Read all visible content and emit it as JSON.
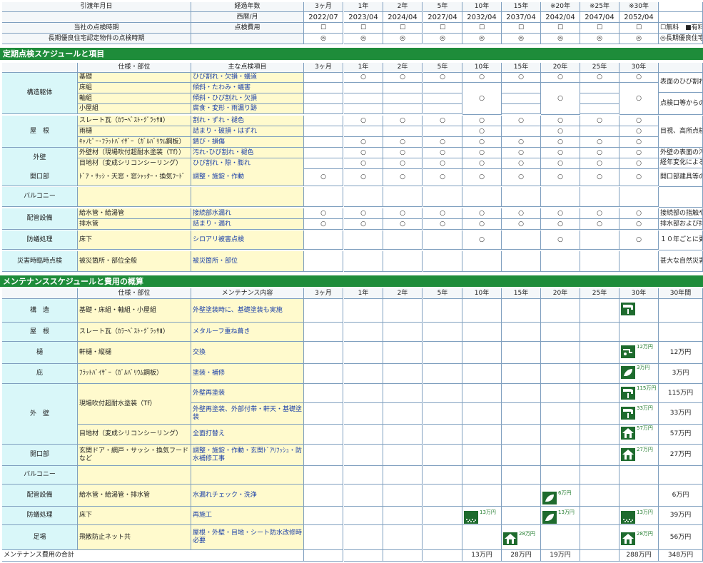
{
  "sched_head": {
    "r1_label": "引渡年月日",
    "r1_mid": "経過年数",
    "r2_mid": "西暦/月",
    "years": [
      "3ヶ月",
      "1年",
      "2年",
      "5年",
      "10年",
      "15年",
      "※20年",
      "※25年",
      "※30年"
    ],
    "dates": [
      "2022/07",
      "2023/04",
      "2024/04",
      "2027/04",
      "2032/04",
      "2037/04",
      "2042/04",
      "2047/04",
      "2052/04"
    ],
    "r3_label": "当社の点検時期",
    "r3_mid": "点検費用",
    "r3_marks": [
      "☐",
      "☐",
      "☐",
      "☐",
      "☐",
      "☐",
      "☐",
      "☐",
      "☐"
    ],
    "r3_note": "☐無料　■有料",
    "r4_label": "長期優良住宅認定物件の点検時期",
    "r4_marks": [
      "◎",
      "◎",
      "◎",
      "◎",
      "◎",
      "◎",
      "◎",
      "◎",
      "◎"
    ],
    "r4_note": "◎長期優良住宅"
  },
  "section1": {
    "title": "定期点検スケジュールと項目",
    "col_spec": "仕様・部位",
    "col_item": "主な点検項目",
    "intervals": [
      "3ヶ月",
      "1年",
      "2年",
      "5年",
      "10年",
      "15年",
      "20年",
      "25年",
      "30年"
    ],
    "groups": [
      {
        "name": "構造躯体",
        "note": "表面のひび割れ",
        "note2": "点検口等からの"
      },
      {
        "name": "屋　根",
        "note": "目視、高所点検"
      },
      {
        "name": "外壁",
        "note": "外壁の表面の汚",
        "note2": "経年変化による"
      },
      {
        "name": "開口部",
        "note": "開口部建具等の"
      },
      {
        "name": "バルコニー"
      },
      {
        "name": "配管設備",
        "note": "接続部の指触や",
        "note2": "排水部および排"
      },
      {
        "name": "防蟻処理",
        "note": "１０年ごとに更"
      },
      {
        "name": "災害時臨時点検",
        "note": "甚大な自然災害"
      }
    ],
    "rows": [
      {
        "spec": "基礎",
        "item": "ひび割れ・欠損・蟻道",
        "marks": [
          "",
          "○",
          "○",
          "○",
          "○",
          "○",
          "○",
          "○",
          "○"
        ]
      },
      {
        "spec": "床組",
        "item": "傾斜・たわみ・蟻害"
      },
      {
        "spec": "軸組",
        "item": "傾斜・ひび割れ・欠損"
      },
      {
        "spec": "小屋組",
        "item": "腐食・変形・雨漏り跡"
      },
      {
        "spec": "スレート瓦（ｶﾗｰﾍﾞｽﾄ･ｸﾞﾗｯｻⅡ）",
        "item": "割れ・ずれ・褪色",
        "marks": [
          "",
          "○",
          "○",
          "○",
          "○",
          "○",
          "○",
          "○",
          "○"
        ]
      },
      {
        "spec": "雨樋",
        "item": "詰まり・破損・はずれ",
        "marks": [
          "",
          "",
          "",
          "",
          "○",
          "",
          "○",
          "",
          "○"
        ]
      },
      {
        "spec": "ｷｬﾉﾋﾟｰ･ﾌﾗｯﾄﾊﾞｲｻﾞｰ（ｶﾞﾙﾊﾞﾘｳﾑ鋼板）",
        "item": "錆び・損傷",
        "marks": [
          "",
          "○",
          "○",
          "○",
          "○",
          "○",
          "○",
          "○",
          "○"
        ]
      },
      {
        "spec": "外壁材（現場吹付超耐水塗装（Tf））",
        "item": "汚れ･ひび割れ・褪色",
        "marks": [
          "",
          "○",
          "○",
          "○",
          "○",
          "○",
          "○",
          "○",
          "○"
        ]
      },
      {
        "spec": "目地材（変成シリコンシーリング）",
        "item": "ひび割れ・隙・膨れ",
        "marks": [
          "",
          "○",
          "○",
          "○",
          "○",
          "○",
          "○",
          "○",
          "○"
        ]
      },
      {
        "spec": "ﾄﾞｱ・ｻｯｼ・天窓・窓ｼｬｯﾀｰ・換気ﾌｰﾄﾞ",
        "item": "調整・施錠・作動",
        "marks": [
          "○",
          "○",
          "○",
          "○",
          "○",
          "○",
          "○",
          "○",
          "○"
        ]
      },
      {
        "spec": "",
        "item": ""
      },
      {
        "spec": "給水管・給湯管",
        "item": "接続部水漏れ",
        "marks": [
          "○",
          "○",
          "○",
          "○",
          "○",
          "○",
          "○",
          "○",
          "○"
        ]
      },
      {
        "spec": "排水管",
        "item": "詰まり・漏れ",
        "marks": [
          "○",
          "○",
          "○",
          "○",
          "○",
          "○",
          "○",
          "○",
          "○"
        ]
      },
      {
        "spec": "床下",
        "item": "シロアリ被害点検",
        "marks": [
          "",
          "",
          "",
          "",
          "○",
          "",
          "○",
          "",
          "○"
        ]
      },
      {
        "spec": "被災箇所・部位全般",
        "item": "被災箇所・部位"
      }
    ],
    "structure_marks": [
      "○",
      "○",
      "○"
    ]
  },
  "section2": {
    "title": "メンテナンススケジュールと費用の概算",
    "col_spec": "仕様・部位",
    "col_item": "メンテナンス内容",
    "intervals": [
      "3ヶ月",
      "1年",
      "2年",
      "5年",
      "10年",
      "15年",
      "20年",
      "25年",
      "30年",
      "30年間"
    ],
    "rows": [
      {
        "group": "構　造",
        "spec": "基礎・床組・軸組・小屋組",
        "item": "外壁塗装時に、基礎塗装も実施",
        "total": ""
      },
      {
        "group": "屋　根",
        "spec": "スレート瓦（ｶﾗｰﾍﾞｽﾄ･ｸﾞﾗｯｻⅡ）",
        "item": "メタルーフ重ね葺き",
        "total": ""
      },
      {
        "group": "樋",
        "spec": "軒樋・縦樋",
        "item": "交換",
        "total": "12万円"
      },
      {
        "group": "庇",
        "spec": "ﾌﾗｯﾄﾊﾞｲｻﾞｰ（ｶﾞﾙﾊﾞﾘｳﾑ鋼板）",
        "item": "塗装・補修",
        "total": "3万円"
      },
      {
        "group": "外　壁",
        "spec": "現場吹付超耐水塗装（Tf）",
        "item": "外壁再塗装",
        "total": "115万円"
      },
      {
        "group": "",
        "spec": "",
        "item": "外壁再塗装、外部付帯・軒天・基礎塗装",
        "total": "33万円"
      },
      {
        "group": "",
        "spec": "目地材（変成シリコンシーリング）",
        "item": "全面打替え",
        "total": "57万円"
      },
      {
        "group": "開口部",
        "spec": "玄関ドア・網戸・サッシ・換気フードなど",
        "item": "調整・施錠・作動・玄関ﾄﾞｱﾘﾌｯｼｭ・防水補修工事",
        "total": "27万円"
      },
      {
        "group": "バルコニー",
        "spec": "",
        "item": "",
        "total": ""
      },
      {
        "group": "配管設備",
        "spec": "給水管・給湯管・排水管",
        "item": "水漏れチェック・洗浄",
        "total": "6万円"
      },
      {
        "group": "防蟻処理",
        "spec": "床下",
        "item": "再施工",
        "total": "39万円"
      },
      {
        "group": "足場",
        "spec": "飛散防止ネット共",
        "item": "屋根・外壁・目地・シート防水改修時必要",
        "total": "56万円"
      }
    ],
    "prices": {
      "gutter_30": "12万円",
      "eaves_30": "3万円",
      "wall_a_30": "115万円",
      "wall_b_30": "33万円",
      "joint_30": "57万円",
      "opening_30": "27万円",
      "pipe_20": "6万円",
      "ant_10": "13万円",
      "ant_20": "13万円",
      "ant_30": "13万円",
      "scaffold_15": "28万円",
      "scaffold_30": "28万円"
    },
    "footer": {
      "label": "メンテナンス費用の合計",
      "sums": [
        "",
        "",
        "",
        "",
        "13万円",
        "28万円",
        "19万円",
        "",
        "288万円",
        "348万円"
      ]
    }
  },
  "colors": {
    "section_green": "#1e8c3a",
    "spec_yellow": "#fffacd",
    "group_cyan": "#d9f7f9",
    "link_blue": "#1a3fa8",
    "icon_green": "#1e6b2e"
  }
}
